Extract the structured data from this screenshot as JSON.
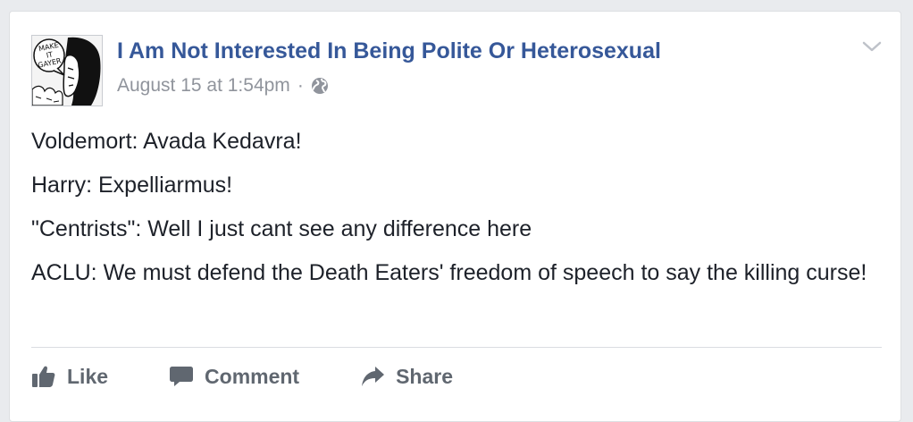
{
  "post": {
    "page_name": "I Am Not Interested In Being Polite Or Heterosexual",
    "timestamp": "August 15 at 1:54pm",
    "separator": "·",
    "privacy_icon": "globe-icon",
    "menu_icon": "chevron-down-icon",
    "avatar_text": [
      "MAKE",
      "IT",
      "GAYER"
    ],
    "lines": [
      "Voldemort: Avada Kedavra!",
      "Harry: Expelliarmus!",
      "\"Centrists\": Well I just cant see any difference here",
      "ACLU: We must defend the Death Eaters' freedom of speech to say the killing curse!"
    ]
  },
  "actions": {
    "like_label": "Like",
    "comment_label": "Comment",
    "share_label": "Share"
  },
  "colors": {
    "link": "#365899",
    "meta": "#90949c",
    "text": "#1d2129",
    "action": "#606770",
    "background": "#e9ebee"
  }
}
